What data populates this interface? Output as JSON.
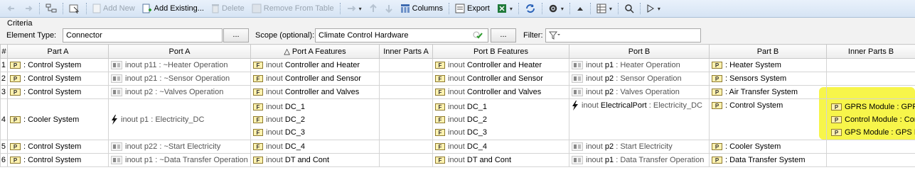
{
  "toolbar": {
    "add_new": "Add New",
    "add_existing": "Add Existing...",
    "delete": "Delete",
    "remove_from_table": "Remove From Table",
    "columns": "Columns",
    "export": "Export"
  },
  "criteria": {
    "title": "Criteria",
    "element_type_label": "Element Type:",
    "element_type_value": "Connector",
    "dots": "...",
    "scope_label": "Scope (optional):",
    "scope_value": "Climate Control Hardware",
    "filter_label": "Filter:"
  },
  "table": {
    "headers": [
      "#",
      "Part A",
      "Port A",
      "△ Port A Features",
      "Inner Parts A",
      "Port B Features",
      "Port B",
      "Part B",
      "Inner Parts B"
    ],
    "rows": [
      {
        "num": "1",
        "part_a": ": Control System",
        "port_a": {
          "kw": "inout",
          "name": "p11 : ~Heater Operation",
          "icon": "port-icon"
        },
        "port_a_features": [
          {
            "kw": "inout",
            "name": "Controller and Heater"
          }
        ],
        "port_b_features": [
          {
            "kw": "inout",
            "name": "Controller and Heater"
          }
        ],
        "port_b": {
          "kw": "inout",
          "name": "p1",
          "type": " : Heater Operation",
          "icon": "port-icon"
        },
        "part_b": ": Heater System",
        "inner_parts_b": []
      },
      {
        "num": "2",
        "part_a": ": Control System",
        "port_a": {
          "kw": "inout",
          "name": "p21 : ~Sensor Operation",
          "icon": "port-icon"
        },
        "port_a_features": [
          {
            "kw": "inout",
            "name": "Controller and Sensor"
          }
        ],
        "port_b_features": [
          {
            "kw": "inout",
            "name": "Controller and Sensor"
          }
        ],
        "port_b": {
          "kw": "inout",
          "name": "p2",
          "type": " : Sensor Operation",
          "icon": "port-icon"
        },
        "part_b": ": Sensors System",
        "inner_parts_b": []
      },
      {
        "num": "3",
        "part_a": ": Control System",
        "port_a": {
          "kw": "inout",
          "name": "p2 : ~Valves Operation",
          "icon": "port-icon"
        },
        "port_a_features": [
          {
            "kw": "inout",
            "name": "Controller and Valves"
          }
        ],
        "port_b_features": [
          {
            "kw": "inout",
            "name": "Controller and Valves"
          }
        ],
        "port_b": {
          "kw": "inout",
          "name": "p2",
          "type": " : Valves Operation",
          "icon": "port-icon"
        },
        "part_b": ": Air Transfer System",
        "inner_parts_b": []
      },
      {
        "num": "4",
        "part_a": ": Cooler System",
        "port_a": {
          "kw": "inout",
          "name": "p1 : Electricity_DC",
          "icon": "bolt-icon"
        },
        "port_a_features": [
          {
            "kw": "inout",
            "name": "DC_1"
          },
          {
            "kw": "inout",
            "name": "DC_2"
          },
          {
            "kw": "inout",
            "name": "DC_3"
          }
        ],
        "port_b_features": [
          {
            "kw": "inout",
            "name": "DC_1"
          },
          {
            "kw": "inout",
            "name": "DC_2"
          },
          {
            "kw": "inout",
            "name": "DC_3"
          }
        ],
        "port_b": {
          "kw": "inout",
          "name": "ElectricalPort",
          "type": " : Electricity_DC",
          "icon": "bolt-icon"
        },
        "part_b": ": Control System",
        "inner_parts_b": [
          "GPRS Module : GPRS",
          "Control Module : Con",
          "GPS Module : GPS Mo"
        ]
      },
      {
        "num": "5",
        "part_a": ": Control System",
        "port_a": {
          "kw": "inout",
          "name": "p22 : ~Start Electricity",
          "icon": "port-icon"
        },
        "port_a_features": [
          {
            "kw": "inout",
            "name": "DC_4"
          }
        ],
        "port_b_features": [
          {
            "kw": "inout",
            "name": "DC_4"
          }
        ],
        "port_b": {
          "kw": "inout",
          "name": "p2",
          "type": " : Start Electricity",
          "icon": "port-icon"
        },
        "part_b": ": Cooler System",
        "inner_parts_b": []
      },
      {
        "num": "6",
        "part_a": ": Control System",
        "port_a": {
          "kw": "inout",
          "name": "p1 : ~Data Transfer Operation",
          "icon": "port-icon"
        },
        "port_a_features": [
          {
            "kw": "inout",
            "name": "DT and Cont"
          }
        ],
        "port_b_features": [
          {
            "kw": "inout",
            "name": "DT and Cont"
          }
        ],
        "port_b": {
          "kw": "inout",
          "name": "p1",
          "type": " : Data Transfer Operation",
          "icon": "port-icon"
        },
        "part_b": ": Data Transfer System",
        "inner_parts_b": []
      }
    ]
  },
  "icons": {
    "part": "P",
    "feature": "F"
  },
  "colors": {
    "highlight": "#f7f54a",
    "toolbar_bg": "#dde9f7"
  }
}
